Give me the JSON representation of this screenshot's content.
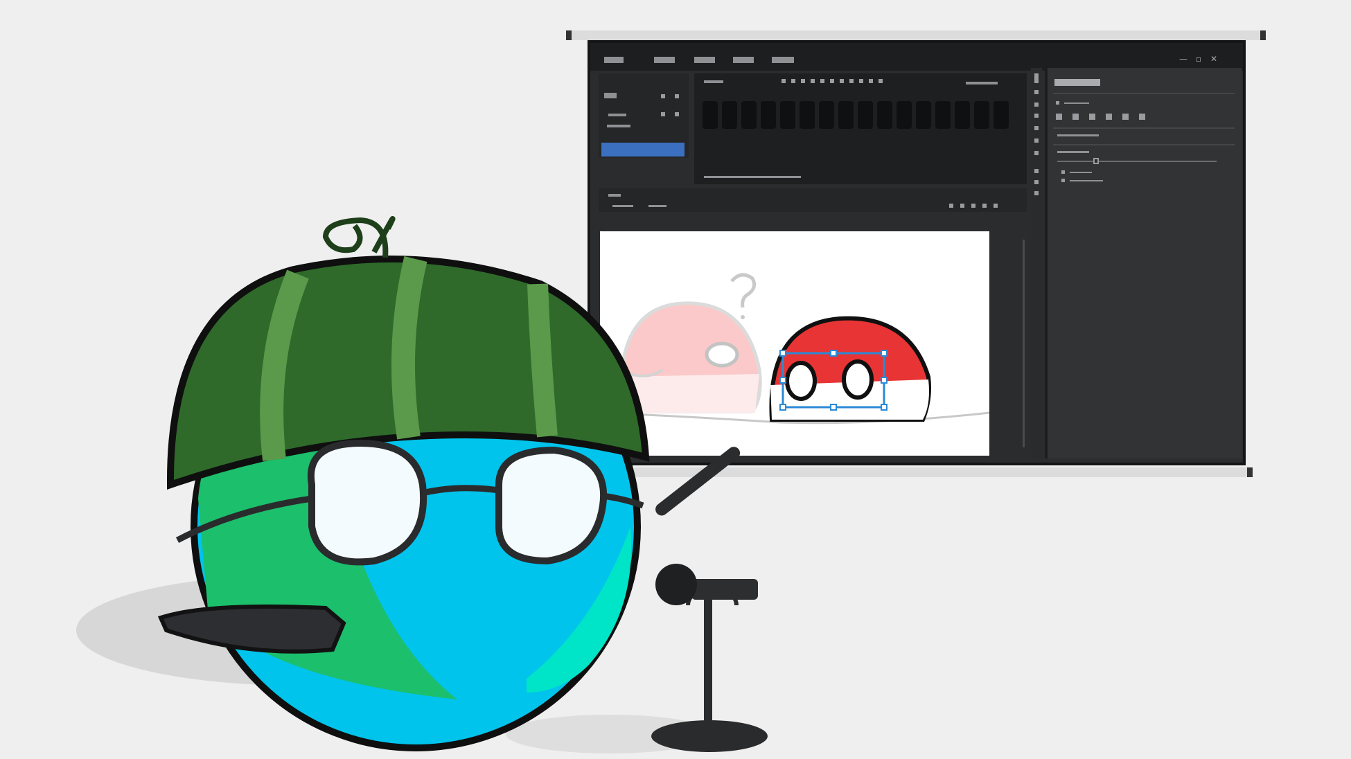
{
  "scene": {
    "description_icons": [
      "watermelon-hat-icon",
      "glasses-icon",
      "microphone-icon",
      "projector-screen-icon",
      "editor-window-icon"
    ],
    "colors": {
      "background": "#efefef",
      "watermelon_dark": "#2f6a2b",
      "watermelon_light": "#4f8a43",
      "ball_cyan": "#18c8e8",
      "ball_green": "#1fbf6f",
      "editor_bg": "#2b2c2e",
      "selection_blue": "#3b6fbf",
      "poland_red": "#e63232"
    }
  },
  "editor": {
    "window_controls": [
      "—",
      "▫",
      "✕"
    ]
  }
}
